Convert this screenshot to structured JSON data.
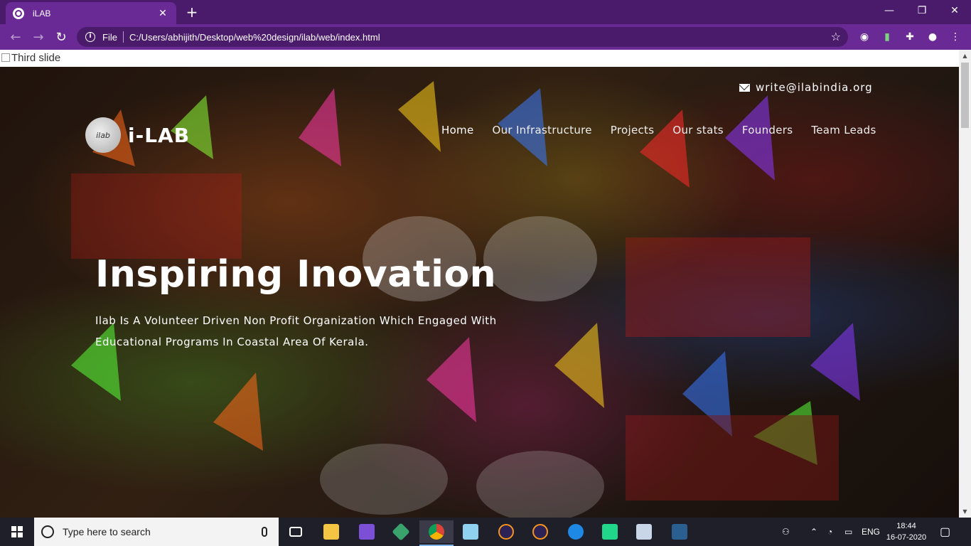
{
  "browser": {
    "tab_title": "iLAB",
    "scheme_label": "File",
    "url": "C:/Users/abhijith/Desktop/web%20design/ilab/web/index.html"
  },
  "page": {
    "broken_image_alt": "Third slide",
    "email": "write@ilabindia.org",
    "logo_text": "i-LAB",
    "logo_mark": "ilab",
    "nav": [
      {
        "label": "Home",
        "active": true
      },
      {
        "label": "Our Infrastructure"
      },
      {
        "label": "Projects"
      },
      {
        "label": "Our stats"
      },
      {
        "label": "Founders"
      },
      {
        "label": "Team Leads"
      }
    ],
    "headline": "Inspiring Inovation",
    "tagline": "Ilab Is A Volunteer Driven Non Profit Organization Which Engaged With Educational Programs In Coastal Area Of Kerala."
  },
  "taskbar": {
    "search_placeholder": "Type here to search",
    "language": "ENG",
    "time": "18:44",
    "date": "16-07-2020"
  },
  "colors": {
    "chrome_dark": "#4a1a6b",
    "chrome_light": "#6a2a96"
  }
}
